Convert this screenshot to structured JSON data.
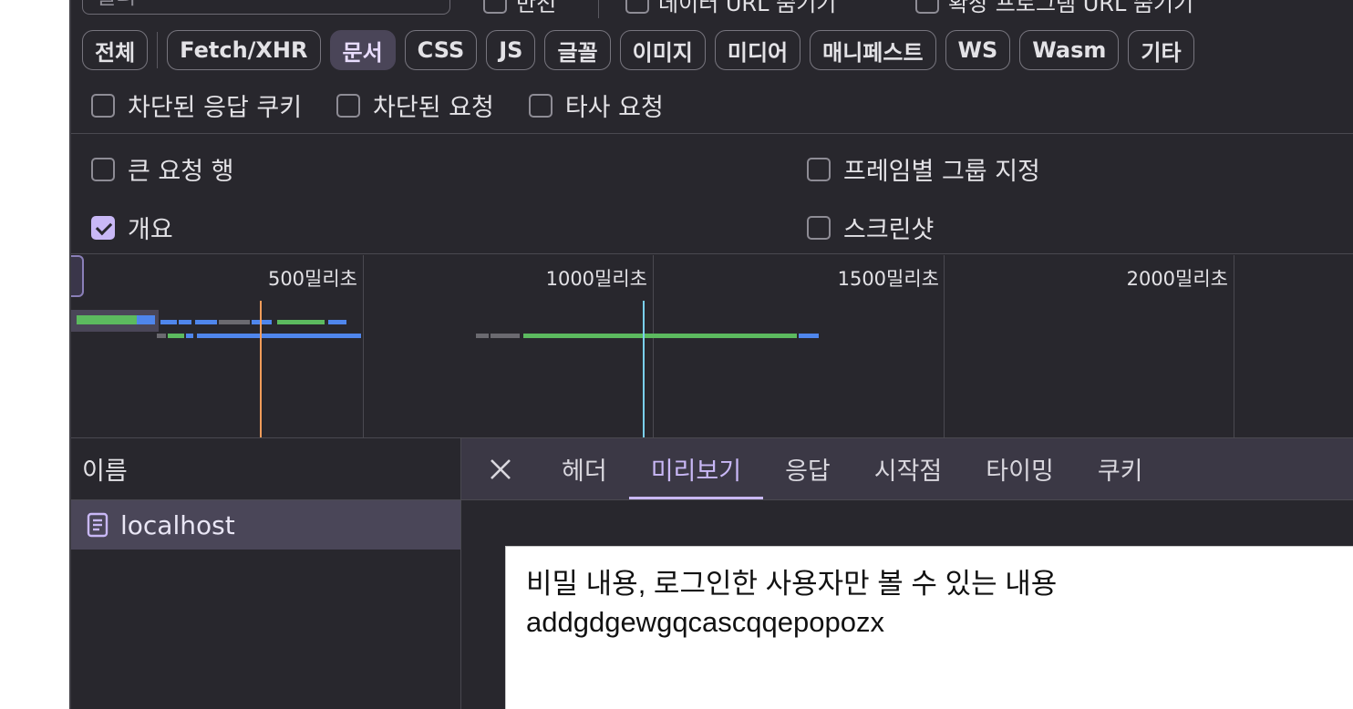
{
  "top": {
    "filter_placeholder": "필터",
    "checkboxes": [
      "반전",
      "데이터 URL 숨기기",
      "확장 프로그램 URL 숨기기"
    ]
  },
  "type_filters": [
    {
      "label": "전체",
      "active": false
    },
    {
      "label": "Fetch/XHR",
      "active": false
    },
    {
      "label": "문서",
      "active": true
    },
    {
      "label": "CSS",
      "active": false
    },
    {
      "label": "JS",
      "active": false
    },
    {
      "label": "글꼴",
      "active": false
    },
    {
      "label": "이미지",
      "active": false
    },
    {
      "label": "미디어",
      "active": false
    },
    {
      "label": "매니페스트",
      "active": false
    },
    {
      "label": "WS",
      "active": false
    },
    {
      "label": "Wasm",
      "active": false
    },
    {
      "label": "기타",
      "active": false
    }
  ],
  "filter_checkboxes": [
    {
      "label": "차단된 응답 쿠키",
      "checked": false
    },
    {
      "label": "차단된 요청",
      "checked": false
    },
    {
      "label": "타사 요청",
      "checked": false
    }
  ],
  "settings": {
    "large_rows": {
      "label": "큰 요청 행",
      "checked": false
    },
    "overview": {
      "label": "개요",
      "checked": true
    },
    "group_by_frame": {
      "label": "프레임별 그룹 지정",
      "checked": false
    },
    "screenshots": {
      "label": "스크린샷",
      "checked": false
    }
  },
  "timeline": {
    "ticks": [
      "500밀리초",
      "1000밀리초",
      "1500밀리초",
      "2000밀리초"
    ],
    "colors": {
      "green": "#5cba5f",
      "blue": "#4f86ec",
      "gray": "#6b6a70",
      "orange": "#f39c5a",
      "cyan": "#7ad0f0"
    }
  },
  "requests": {
    "column_header": "이름",
    "rows": [
      {
        "name": "localhost",
        "icon": "document-icon"
      }
    ]
  },
  "detail_tabs": [
    "헤더",
    "미리보기",
    "응답",
    "시작점",
    "타이밍",
    "쿠키"
  ],
  "active_detail_tab": "미리보기",
  "preview": {
    "line1": "비밀 내용, 로그인한 사용자만 볼 수 있는 내용",
    "line2": "addgdgewgqcascqqepopozx"
  }
}
